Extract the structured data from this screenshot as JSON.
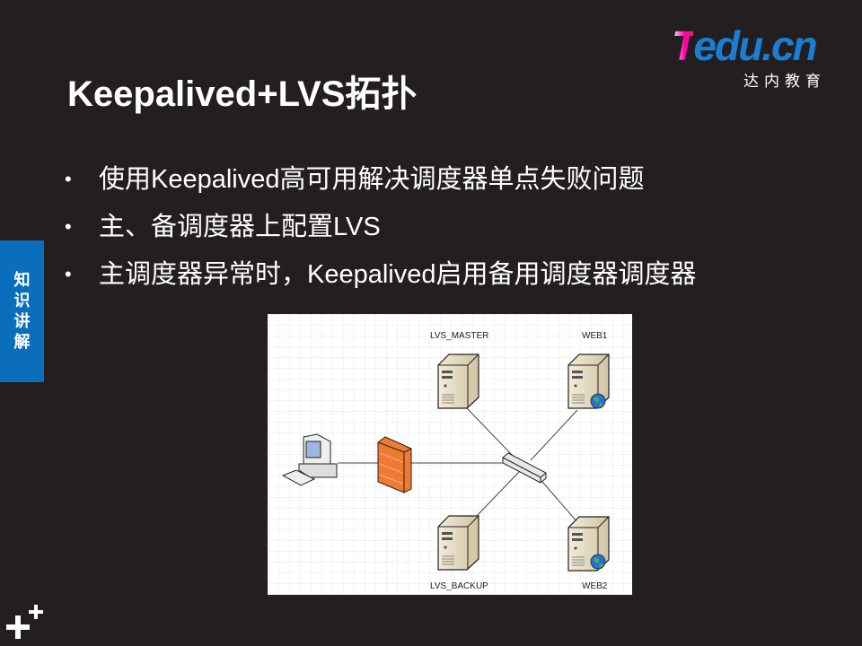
{
  "slide": {
    "title": "Keepalived+LVS拓扑",
    "bullets": [
      "使用Keepalived高可用解决调度器单点失败问题",
      "主、备调度器上配置LVS",
      "主调度器异常时，Keepalived启用备用调度器调度器"
    ],
    "side_tab": [
      "知",
      "识",
      "讲",
      "解"
    ]
  },
  "logo": {
    "brand_t": "T",
    "brand_rest": "edu.cn",
    "subtitle": "达内教育"
  },
  "diagram": {
    "labels": {
      "master": "LVS_MASTER",
      "backup": "LVS_BACKUP",
      "web1": "WEB1",
      "web2": "WEB2"
    }
  },
  "colors": {
    "background": "#231f20",
    "side_tab": "#0a6ebd",
    "logo_blue": "#1a7fd4",
    "firewall": "#f07a30"
  }
}
